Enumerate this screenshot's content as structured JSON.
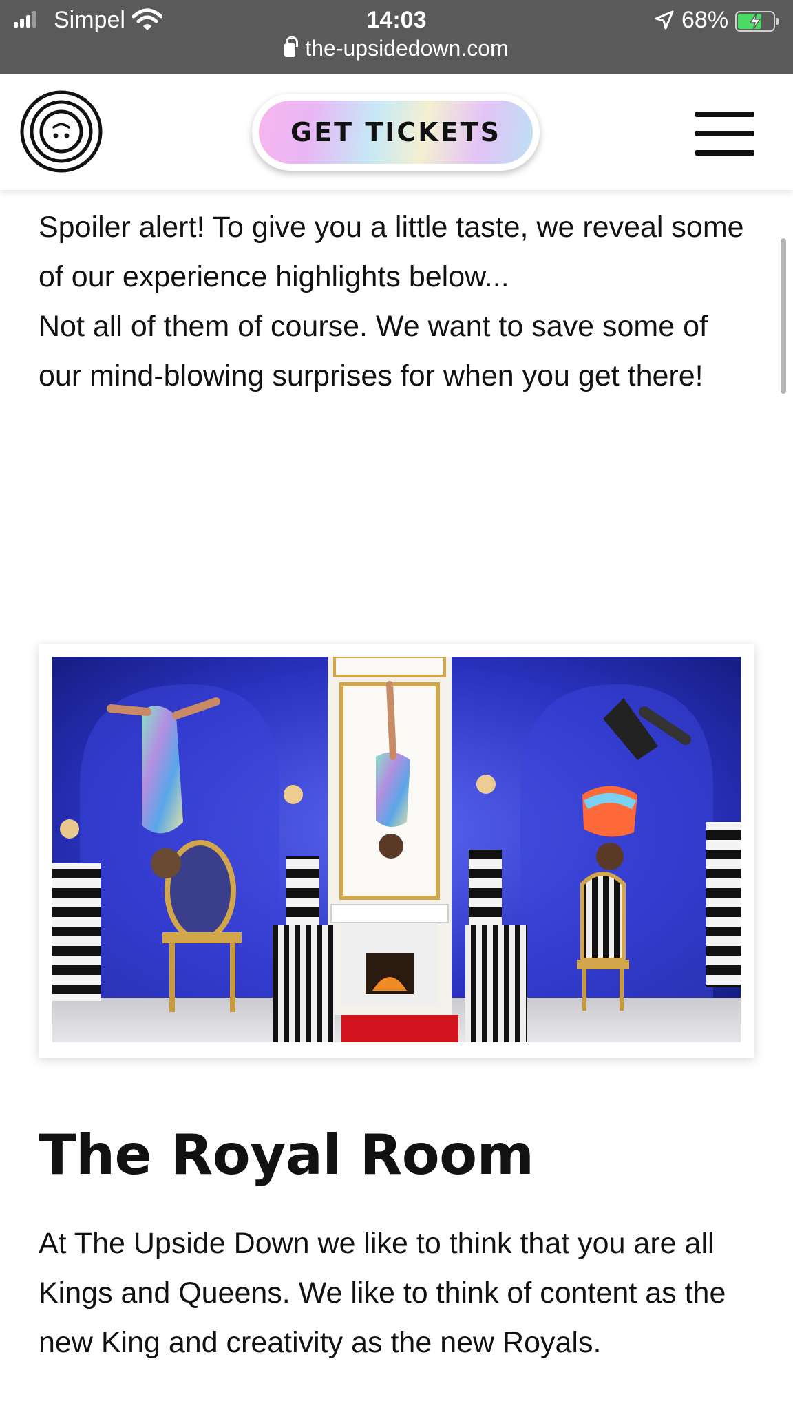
{
  "status_bar": {
    "carrier": "Simpel",
    "time": "14:03",
    "battery_percent": "68%",
    "battery_level": 0.68,
    "url": "the-upsidedown.com"
  },
  "header": {
    "get_tickets_label": "GET TICKETS"
  },
  "intro": {
    "line1": "Spoiler alert! To give you a little taste, we reveal some of our experience highlights below...",
    "line2": "Not all of them of course. We want to save some of our mind-blowing surprises for when you get there!"
  },
  "room": {
    "title": "The Royal Room",
    "description": "At The Upside Down we like to think that you are all Kings and Queens. We like to think of content as the new King and creativity as the new Royals."
  },
  "colors": {
    "status_bg": "#5a5a5a",
    "battery_green": "#4cd964",
    "photo_wall_blue": "#2f34b8",
    "carpet_red": "#d0131c"
  }
}
